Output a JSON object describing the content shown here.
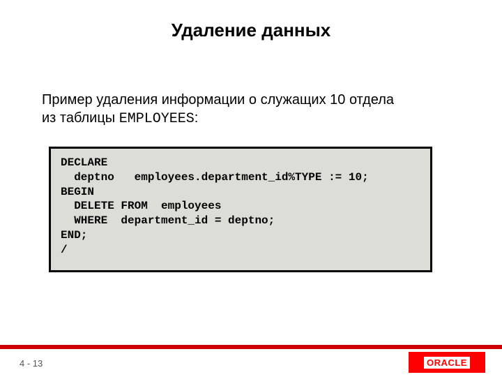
{
  "title": "Удаление данных",
  "body": {
    "line1": "Пример удаления  информации о служащих 10 отдела",
    "line2_prefix": "из таблицы ",
    "line2_mono": "EMPLOYEES",
    "line2_suffix": ":"
  },
  "code": "DECLARE\n  deptno   employees.department_id%TYPE := 10; \nBEGIN\n  DELETE FROM  employees\n  WHERE  department_id = deptno;\nEND;\n/",
  "footer": {
    "page": "4 - 13",
    "logo": "ORACLE"
  }
}
